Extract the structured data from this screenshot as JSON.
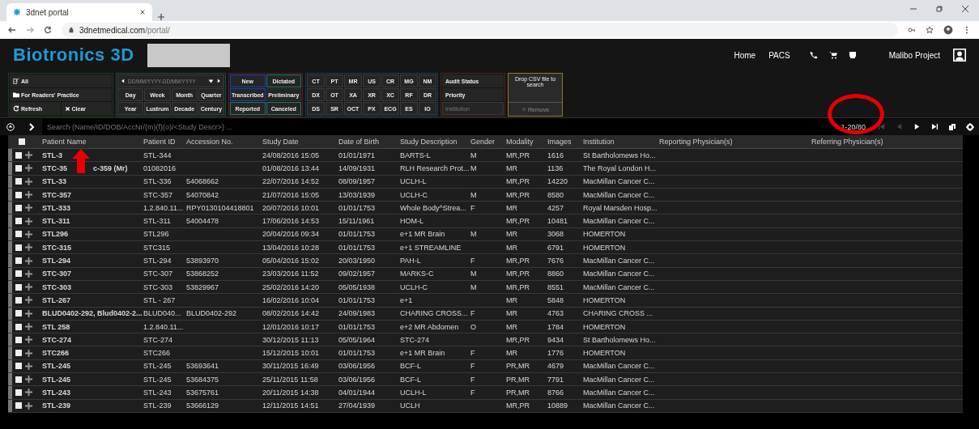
{
  "browser": {
    "tab_title": "3dnet portal",
    "url_host": "3dnetmedical.com",
    "url_path": "/portal/"
  },
  "header": {
    "logo": "Biotronics 3D",
    "nav": [
      "Home",
      "PACS"
    ],
    "user": "Malibo Project"
  },
  "filters": {
    "quick": [
      "All",
      "For Readers' Practice"
    ],
    "refresh": "Refresh",
    "clear": "Clear",
    "date_placeholder": "DD/MM/YYYY-DD/MM/YYYY",
    "periods": [
      "Day",
      "Week",
      "Month",
      "Quarter",
      "Year",
      "Lustrum",
      "Decade",
      "Century"
    ],
    "statuses": [
      "New",
      "Dictated",
      "Transcribed",
      "Preliminary",
      "Reported",
      "Canceled"
    ],
    "modalities": [
      "CT",
      "PT",
      "MR",
      "US",
      "CR",
      "MG",
      "NM",
      "DX",
      "OT",
      "XA",
      "XR",
      "XC",
      "RF",
      "DR",
      "DS",
      "SR",
      "OCT",
      "PX",
      "ECG",
      "ES",
      "IO"
    ],
    "audit": [
      "Audit Status",
      "Priority"
    ],
    "institution_placeholder": "Institution",
    "csv_drop": "Drop CSV file to search",
    "csv_remove": {
      "label": "Remove",
      "disabled": true
    }
  },
  "search": {
    "placeholder": "Search (Name/ID/DOB/AccNr/(m)(f)(o)/<Study Descr>) ..."
  },
  "pagination": "1-20/80",
  "table": {
    "select_all": {
      "checked": false
    },
    "columns": [
      "Patient Name",
      "Patient ID",
      "Accession No.",
      "Study Date",
      "Date of Birth",
      "Study Description",
      "Gender",
      "Modality",
      "Images",
      "Institution",
      "Reporting Physician(s)",
      "Referring Physician(s)"
    ],
    "rows": [
      {
        "checked": false,
        "name": "STL-3",
        "id": "STL-344",
        "acc": "",
        "date": "24/08/2016 15:05",
        "dob": "01/01/1971",
        "desc": "BARTS-L",
        "gender": "M",
        "modality": "MR,PR",
        "images": "1616",
        "inst": "St Bartholomews Ho..."
      },
      {
        "checked": false,
        "name": "STC-35",
        "name_tail": "c-359 (Mr)",
        "id": "01082016",
        "acc": "",
        "date": "01/08/2016 13:44",
        "dob": "14/09/1931",
        "desc": "RLH Research Prot...",
        "gender": "M",
        "modality": "MR",
        "images": "1136",
        "inst": "The Royal London H..."
      },
      {
        "checked": false,
        "name": "STL-33",
        "id": "STL-336",
        "acc": "54068662",
        "date": "22/07/2016 14:52",
        "dob": "08/09/1957",
        "desc": "UCLH-L",
        "gender": "",
        "modality": "MR,PR",
        "images": "14220",
        "inst": "MacMillan Cancer C..."
      },
      {
        "checked": false,
        "name": "STC-357",
        "id": "STC-357",
        "acc": "54070842",
        "date": "21/07/2016 15:05",
        "dob": "13/03/1939",
        "desc": "UCLH-C",
        "gender": "M",
        "modality": "MR,PR",
        "images": "8580",
        "inst": "MacMillan Cancer C..."
      },
      {
        "checked": false,
        "name": "STL-333",
        "id": "1.2.840.11...",
        "acc": "RPY0130104418801",
        "date": "20/07/2016 10:01",
        "dob": "01/01/1753",
        "desc": "Whole Body^Strea...",
        "gender": "F",
        "modality": "MR",
        "images": "4257",
        "inst": "Royal Marsden Hosp..."
      },
      {
        "checked": false,
        "name": "STL-311",
        "id": "STL-311",
        "acc": "54004478",
        "date": "17/06/2016 14:53",
        "dob": "15/11/1961",
        "desc": "HOM-L",
        "gender": "",
        "modality": "MR,PR",
        "images": "10481",
        "inst": "MacMillan Cancer C..."
      },
      {
        "checked": false,
        "name": "STL296",
        "id": "STL296",
        "acc": "",
        "date": "20/04/2016 09:34",
        "dob": "01/01/1753",
        "desc": "e+1 MR Brain",
        "gender": "M",
        "modality": "MR",
        "images": "3068",
        "inst": "HOMERTON"
      },
      {
        "checked": false,
        "name": "STC-315",
        "id": "STC315",
        "acc": "",
        "date": "13/04/2016 10:28",
        "dob": "01/01/1753",
        "desc": "e+1 STREAMLINE",
        "gender": "",
        "modality": "MR",
        "images": "6791",
        "inst": "HOMERTON"
      },
      {
        "checked": false,
        "name": "STL-294",
        "id": "STL-294",
        "acc": "53893970",
        "date": "05/04/2016 15:02",
        "dob": "20/03/1950",
        "desc": "PAH-L",
        "gender": "F",
        "modality": "MR,PR",
        "images": "7676",
        "inst": "MacMillan Cancer C..."
      },
      {
        "checked": false,
        "name": "STC-307",
        "id": "STC-307",
        "acc": "53868252",
        "date": "23/03/2016 11:52",
        "dob": "09/02/1957",
        "desc": "MARKS-C",
        "gender": "M",
        "modality": "MR,PR",
        "images": "8860",
        "inst": "MacMillan Cancer C..."
      },
      {
        "checked": false,
        "name": "STC-303",
        "id": "STC-303",
        "acc": "53829967",
        "date": "25/02/2016 14:20",
        "dob": "05/05/1938",
        "desc": "UCLH-C",
        "gender": "M",
        "modality": "MR,PR",
        "images": "8551",
        "inst": "MacMillan Cancer C..."
      },
      {
        "checked": false,
        "name": "STL-267",
        "id": "STL - 267",
        "acc": "",
        "date": "16/02/2016 10:04",
        "dob": "01/01/1753",
        "desc": "e+1",
        "gender": "",
        "modality": "MR",
        "images": "5848",
        "inst": "HOMERTON"
      },
      {
        "checked": false,
        "name": "BLUD0402-292, Blud0402-2...",
        "id": "BLUD040...",
        "acc": "BLUD0402-292",
        "date": "08/02/2016 14:42",
        "dob": "24/09/1983",
        "desc": "CHARING CROSS...",
        "gender": "F",
        "modality": "MR",
        "images": "4763",
        "inst": "CHARING CROSS ..."
      },
      {
        "checked": false,
        "name": "STL 258",
        "id": "1.2.840.11...",
        "acc": "",
        "date": "12/01/2016 10:17",
        "dob": "01/01/1753",
        "desc": "e+2 MR Abdomen",
        "gender": "O",
        "modality": "MR",
        "images": "1784",
        "inst": "HOMERTON"
      },
      {
        "checked": false,
        "name": "STC-274",
        "id": "STC-274",
        "acc": "",
        "date": "30/12/2015 11:13",
        "dob": "05/05/1964",
        "desc": "STC-274",
        "gender": "",
        "modality": "MR,PR",
        "images": "9434",
        "inst": "St Bartholomews Ho..."
      },
      {
        "checked": false,
        "name": "STC266",
        "id": "STC266",
        "acc": "",
        "date": "15/12/2015 10:01",
        "dob": "01/01/1753",
        "desc": "e+1 MR Brain",
        "gender": "F",
        "modality": "MR",
        "images": "1776",
        "inst": "HOMERTON"
      },
      {
        "checked": false,
        "name": "STL-245",
        "id": "STL-245",
        "acc": "53693641",
        "date": "30/11/2015 16:49",
        "dob": "03/06/1956",
        "desc": "BCF-L",
        "gender": "F",
        "modality": "PR,MR",
        "images": "4679",
        "inst": "MacMillan Cancer C..."
      },
      {
        "checked": false,
        "name": "STL-245",
        "id": "STL-245",
        "acc": "53684375",
        "date": "25/11/2015 11:58",
        "dob": "03/06/1956",
        "desc": "BCF-L",
        "gender": "F",
        "modality": "PR,MR",
        "images": "7791",
        "inst": "MacMillan Cancer C..."
      },
      {
        "checked": false,
        "name": "STL-243",
        "id": "STL-243",
        "acc": "53675761",
        "date": "20/11/2015 14:38",
        "dob": "04/01/1944",
        "desc": "UCLH-L",
        "gender": "F",
        "modality": "PR,MR",
        "images": "8766",
        "inst": "MacMillan Cancer C..."
      },
      {
        "checked": false,
        "name": "STL-239",
        "id": "STL-239",
        "acc": "53666129",
        "date": "12/11/2015 14:51",
        "dob": "27/04/1939",
        "desc": "UCLH",
        "gender": "",
        "modality": "MR,PR",
        "images": "10889",
        "inst": "MacMillan Cancer C..."
      }
    ]
  }
}
